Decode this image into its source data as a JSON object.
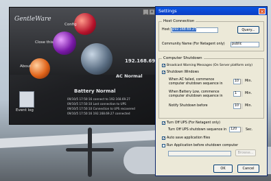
{
  "util": {
    "logo": "GentleWare",
    "config_label": "Config",
    "close_label": "Close this",
    "about_label": "About",
    "eventlog_label": "Event log",
    "ip": "192.168.69.27",
    "status": "AC Normal",
    "battery": "Battery Normal",
    "log": [
      "09/10/5 17:50:16 connect to 192.168.69.27",
      "09/10/5 17:50:10 Lost connection to UPS",
      "09/10/5 17:50:10 Connection to UPS recovered",
      "09/10/5 17:50:16 192.168.69.27 connected"
    ]
  },
  "dialog": {
    "title": "Settings",
    "host_group": "Host Connection",
    "host_label": "Host:",
    "host_value": "192.168.69.27",
    "query_label": "Query...",
    "community_label": "Community Name (For Netagent only)",
    "community_value": "public",
    "shutdown_group": "Computer Shutdown",
    "broadcast_label": "Broadcast Warning Messages (On Server platform only)",
    "shutdown_windows_label": "Shutdown Windows",
    "ac_fail_label": "When AC failed, commence computer shutdown sequence in",
    "ac_fail_value": "10",
    "battery_low_label": "When Battery Low, commence computer shutdown sequence in",
    "battery_low_value": "1",
    "notify_label": "Notify Shutdown before",
    "notify_value": "10",
    "min_label": "Min.",
    "ups_off_label": "Turn Off UPS (For Netagent only)",
    "ups_off_seq_label": "Turn Off UPS shutdown sequence in",
    "ups_off_value": "120",
    "sec_label": "Sec.",
    "auto_save_label": "Auto save application files",
    "run_app_label": "Run Application before shutdown computer",
    "browse_label": "Browse...",
    "ok_label": "OK",
    "cancel_label": "Cancel"
  }
}
